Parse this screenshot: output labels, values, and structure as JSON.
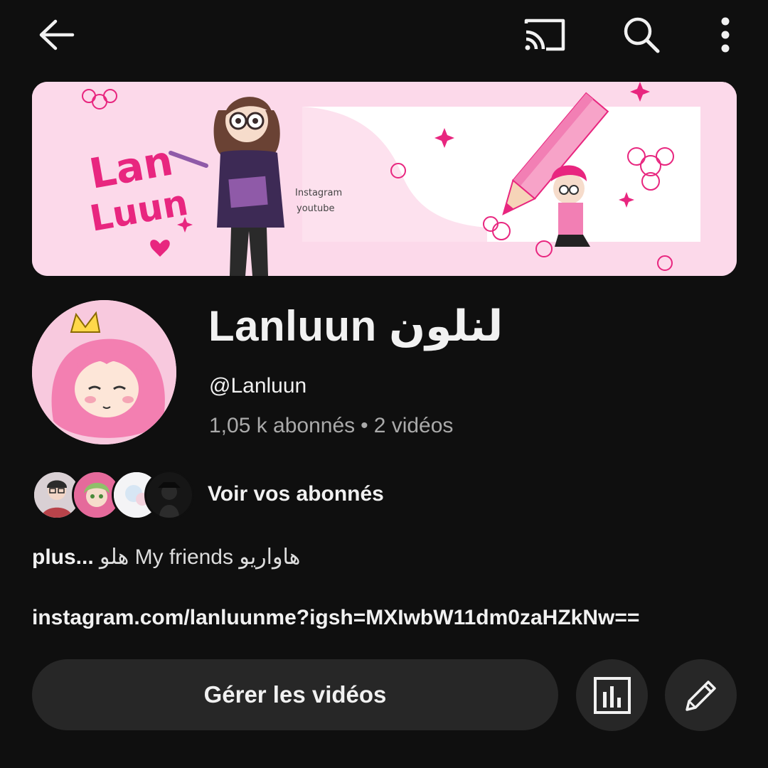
{
  "toolbar": {
    "back_icon": "arrow-left-icon",
    "cast_icon": "cast-icon",
    "search_icon": "search-icon",
    "more_icon": "more-vertical-icon"
  },
  "banner": {
    "logo_text_line1": "Lan",
    "logo_text_line2": "Luun",
    "signature_line1": "Instagram",
    "signature_line2": "youtube"
  },
  "channel": {
    "name": "Lanluun لنلون",
    "handle": "@Lanluun",
    "subscribers": "1,05 k abonnés",
    "separator": "•",
    "videos": "2 vidéos"
  },
  "subscribers_row": {
    "label": "Voir vos abonnés"
  },
  "description": {
    "more": "plus...",
    "text": "هاواريو My friends هلو"
  },
  "link": "instagram.com/lanluunme?igsh=MXIwbW11dm0zaHZkNw==",
  "actions": {
    "manage_label": "Gérer les vidéos",
    "stats_icon": "analytics-icon",
    "edit_icon": "pencil-icon"
  },
  "colors": {
    "background": "#0f0f0f",
    "button_bg": "#272727",
    "accent_pink": "#e8267f",
    "secondary_text": "#aaaaaa"
  }
}
